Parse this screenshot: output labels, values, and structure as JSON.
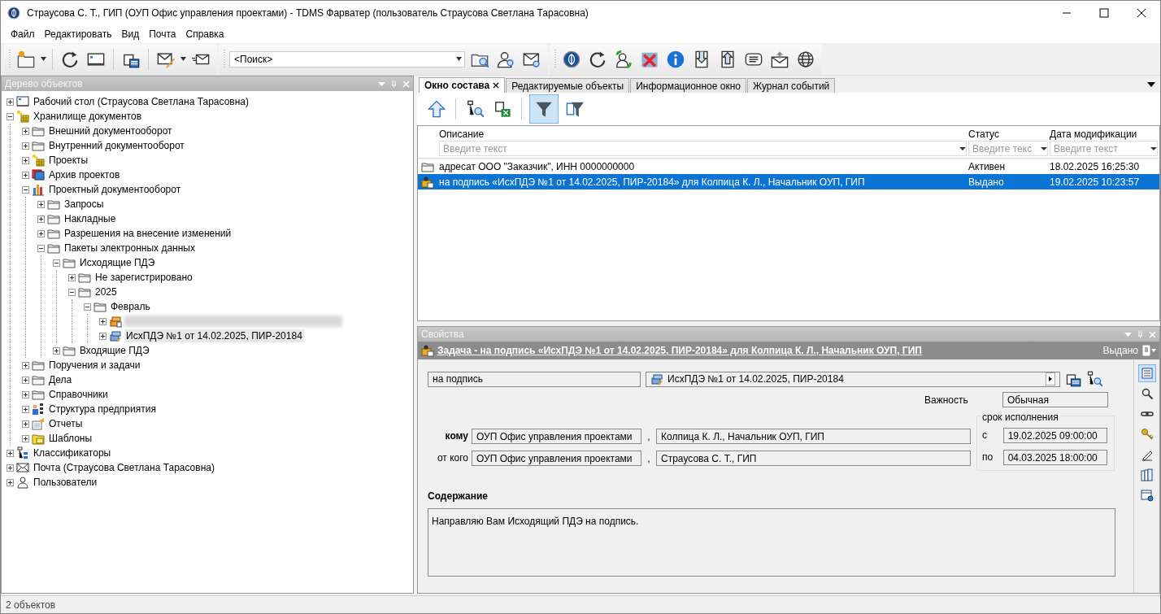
{
  "window": {
    "title": "Страусова С. Т., ГИП (ОУП Офис управления проектами) - TDMS Фарватер (пользователь Страусова Светлана Тарасовна)"
  },
  "menu": [
    "Файл",
    "Редактировать",
    "Вид",
    "Почта",
    "Справка"
  ],
  "search": {
    "value": "<Поиск>"
  },
  "tree_panel": {
    "title": "Дерево объектов"
  },
  "tree": [
    {
      "label": "Рабочий стол (Страусова Светлана Тарасовна)",
      "kind": "desktop",
      "expanded": false,
      "selected": false
    },
    {
      "label": "Хранилище документов",
      "kind": "storage",
      "expanded": true,
      "selected": false,
      "children": [
        {
          "label": "Внешний документооборот",
          "kind": "folder",
          "expanded": false,
          "selected": false
        },
        {
          "label": "Внутренний документооборот",
          "kind": "folder",
          "expanded": false,
          "selected": false
        },
        {
          "label": "Проекты",
          "kind": "storage",
          "expanded": false,
          "selected": false
        },
        {
          "label": "Архив проектов",
          "kind": "archive",
          "expanded": false,
          "selected": false
        },
        {
          "label": "Проектный документооборот",
          "kind": "chart",
          "expanded": true,
          "selected": false,
          "children": [
            {
              "label": "Запросы",
              "kind": "folder",
              "expanded": false,
              "selected": false
            },
            {
              "label": "Накладные",
              "kind": "folder",
              "expanded": false,
              "selected": false
            },
            {
              "label": "Разрешения на внесение изменений",
              "kind": "folder",
              "expanded": false,
              "selected": false
            },
            {
              "label": "Пакеты электронных данных",
              "kind": "folder",
              "expanded": true,
              "selected": false,
              "children": [
                {
                  "label": "Исходящие ПДЭ",
                  "kind": "folder",
                  "expanded": true,
                  "selected": false,
                  "children": [
                    {
                      "label": "Не зарегистрировано",
                      "kind": "folder",
                      "expanded": false,
                      "selected": false
                    },
                    {
                      "label": "2025",
                      "kind": "folder",
                      "expanded": true,
                      "selected": false,
                      "children": [
                        {
                          "label": "Февраль",
                          "kind": "folder",
                          "expanded": true,
                          "selected": false,
                          "children": [
                            {
                              "kind": "redacted-package",
                              "expanded": false,
                              "selected": false
                            },
                            {
                              "label": "ИсхПДЭ №1 от 14.02.2025, ПИР-20184",
                              "kind": "package",
                              "expanded": false,
                              "selected": true
                            }
                          ]
                        }
                      ]
                    }
                  ]
                },
                {
                  "label": "Входящие ПДЭ",
                  "kind": "folder",
                  "expanded": false,
                  "selected": false
                }
              ]
            }
          ]
        },
        {
          "label": "Поручения и задачи",
          "kind": "folder",
          "expanded": false,
          "selected": false
        },
        {
          "label": "Дела",
          "kind": "folder",
          "expanded": false,
          "selected": false
        },
        {
          "label": "Справочники",
          "kind": "folder",
          "expanded": false,
          "selected": false
        },
        {
          "label": "Структура предприятия",
          "kind": "org",
          "expanded": false,
          "selected": false
        },
        {
          "label": "Отчеты",
          "kind": "reports",
          "expanded": false,
          "selected": false
        },
        {
          "label": "Шаблоны",
          "kind": "templates",
          "expanded": false,
          "selected": false
        }
      ]
    },
    {
      "label": "Классификаторы",
      "kind": "classifier",
      "expanded": false,
      "selected": false
    },
    {
      "label": "Почта (Страусова Светлана Тарасовна)",
      "kind": "mail",
      "expanded": false,
      "selected": false
    },
    {
      "label": "Пользователи",
      "kind": "users",
      "expanded": false,
      "selected": false
    }
  ],
  "tabs": [
    {
      "label": "Окно состава",
      "selected": true
    },
    {
      "label": "Редактируемые объекты",
      "selected": false
    },
    {
      "label": "Информационное окно",
      "selected": false
    },
    {
      "label": "Журнал событий",
      "selected": false
    }
  ],
  "content_toolbar": {
    "filter_pressed": true
  },
  "table": {
    "columns": [
      {
        "label": "Описание",
        "placeholder": "Введите текст"
      },
      {
        "label": "Статус",
        "placeholder": "Введите текс"
      },
      {
        "label": "Дата модификации",
        "placeholder": "Введите текст"
      }
    ],
    "rows": [
      {
        "kind": "folder",
        "cells": [
          "адресат ООО \"Заказчик\", ИНН 0000000000",
          "Активен",
          "18.02.2025 16:25:30"
        ],
        "selected": false
      },
      {
        "kind": "task",
        "cells": [
          "на подпись «ИсхПДЭ №1 от 14.02.2025, ПИР-20184» для Колпица К. Л., Начальник ОУП, ГИП",
          "Выдано",
          "19.02.2025 10:23:57"
        ],
        "selected": true
      }
    ]
  },
  "properties": {
    "panel_title": "Свойства",
    "heading": "Задача - на подпись «ИсхПДЭ №1 от 14.02.2025, ПИР-20184» для Колпица К. Л., Начальник ОУП, ГИП",
    "status": "Выдано",
    "type": "на подпись",
    "subject": "ИсхПДЭ №1 от 14.02.2025, ПИР-20184",
    "importance_label": "Важность",
    "importance": "Обычная",
    "to_label": "кому",
    "to_org": "ОУП Офис управления проектами",
    "to_person": "Колпица К. Л., Начальник ОУП, ГИП",
    "from_label": "от кого",
    "from_org": "ОУП Офис управления проектами",
    "from_person": "Страусова С. Т., ГИП",
    "separators": [
      ",",
      ","
    ],
    "deadline_title": "срок исполнения",
    "start_label": "с",
    "start": "19.02.2025 09:00:00",
    "end_label": "по",
    "end": "04.03.2025 18:00:00",
    "content_label": "Содержание",
    "content": "Направляю Вам Исходящий ПДЭ на подпись.",
    "side_tools": [
      {
        "kind": "form",
        "selected": true
      },
      {
        "kind": "search",
        "selected": false
      },
      {
        "kind": "link",
        "selected": false
      },
      {
        "kind": "keys",
        "selected": false
      },
      {
        "kind": "pen",
        "selected": false
      },
      {
        "kind": "books",
        "selected": false
      },
      {
        "kind": "settings",
        "selected": false
      }
    ]
  },
  "status_bar": {
    "text": "2 объектов"
  }
}
